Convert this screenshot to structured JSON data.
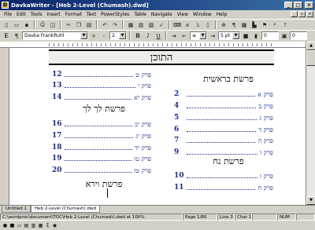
{
  "titlebar": {
    "icon": "davka-icon",
    "title": "DavkaWriter - [Heb 2-Level (Chumash).dwd]"
  },
  "menu": [
    "File",
    "Edit",
    "Tools",
    "Insert",
    "Format",
    "Text",
    "PowerStyles",
    "Table",
    "Navigate",
    "View",
    "Window",
    "Help"
  ],
  "toolbar2": {
    "font": "Davka FrankRuhl",
    "size": "2",
    "spacing": "5 pt",
    "value1": "0",
    "value2": "0"
  },
  "document": {
    "header": "התוכן",
    "right_col": {
      "heading1": "פרשת בראשית",
      "rows1": [
        {
          "num": "2",
          "label": "פרק א"
        },
        {
          "num": "4",
          "label": "פרק ב"
        },
        {
          "num": "5",
          "label": "פרק ג"
        },
        {
          "num": "6",
          "label": "פרק ד"
        },
        {
          "num": "7",
          "label": "פרק ה"
        },
        {
          "num": "9",
          "label": "פרק ו"
        }
      ],
      "heading2": "פרשת נח",
      "rows2": [
        {
          "num": "10",
          "label": "פרק ז"
        },
        {
          "num": "11",
          "label": "פרק ח"
        }
      ]
    },
    "left_col": {
      "rows1": [
        {
          "num": "12",
          "label": "פרק ט"
        },
        {
          "num": "13",
          "label": "פרק י"
        },
        {
          "num": "14",
          "label": "פרק יא"
        }
      ],
      "heading1": "פרשת לך לך",
      "rows2": [
        {
          "num": "16",
          "label": "פרק יב"
        },
        {
          "num": "17",
          "label": "פרק יג"
        },
        {
          "num": "18",
          "label": "פרק יד"
        },
        {
          "num": "19",
          "label": "פרק טו"
        },
        {
          "num": "20",
          "label": "פרק טז"
        }
      ],
      "heading2": "פרשת וירא"
    }
  },
  "tabs": [
    "Untitled 1",
    "Heb 2-Level (Chumash).dwd"
  ],
  "status": {
    "path": "C:\\wordproc\\document\\TOC\\Heb 2-Level (Chumash).dwd at 100%",
    "page": "Page 1/80",
    "line": "Line 3",
    "char": "Char 1",
    "mode": "NUM"
  }
}
